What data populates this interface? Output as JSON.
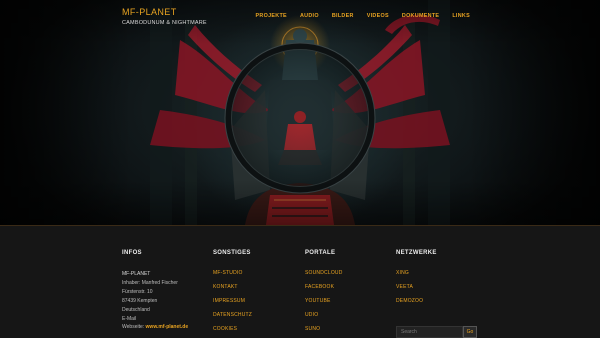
{
  "site": {
    "title": "MF-PLANET",
    "subtitle": "CAMBODUNUM & NIGHTMARE"
  },
  "nav": [
    {
      "label": "PROJEKTE"
    },
    {
      "label": "AUDIO"
    },
    {
      "label": "BILDER"
    },
    {
      "label": "VIDEOS"
    },
    {
      "label": "DOKUMENTE"
    },
    {
      "label": "LINKS"
    }
  ],
  "footer": {
    "infos": {
      "title": "INFOS",
      "name": "MF-PLANET",
      "lines": [
        "Inhaber: Manfred Fischer",
        "Fürstenstr. 10",
        "87439 Kempten",
        "Deutschland",
        "E-Mail"
      ],
      "website_label": "Webseite:",
      "website_link": "www.mf-planet.de"
    },
    "sonstiges": {
      "title": "SONSTIGES",
      "links": [
        "MF-STUDIO",
        "KONTAKT",
        "IMPRESSUM",
        "DATENSCHUTZ",
        "COOKIES"
      ]
    },
    "portale": {
      "title": "PORTALE",
      "links": [
        "SOUNDCLOUD",
        "FACEBOOK",
        "YOUTUBE",
        "UDIO",
        "SUNO"
      ]
    },
    "netzwerke": {
      "title": "NETZWERKE",
      "links": [
        "XING",
        "VEETA",
        "DEMOZOO"
      ]
    },
    "search": {
      "placeholder": "Search",
      "button": "Go"
    }
  },
  "colors": {
    "accent": "#e8a321",
    "red_drape": "#8a1524",
    "background": "#141414"
  },
  "icons": {
    "magnifier": "magnifier-lens-icon"
  }
}
